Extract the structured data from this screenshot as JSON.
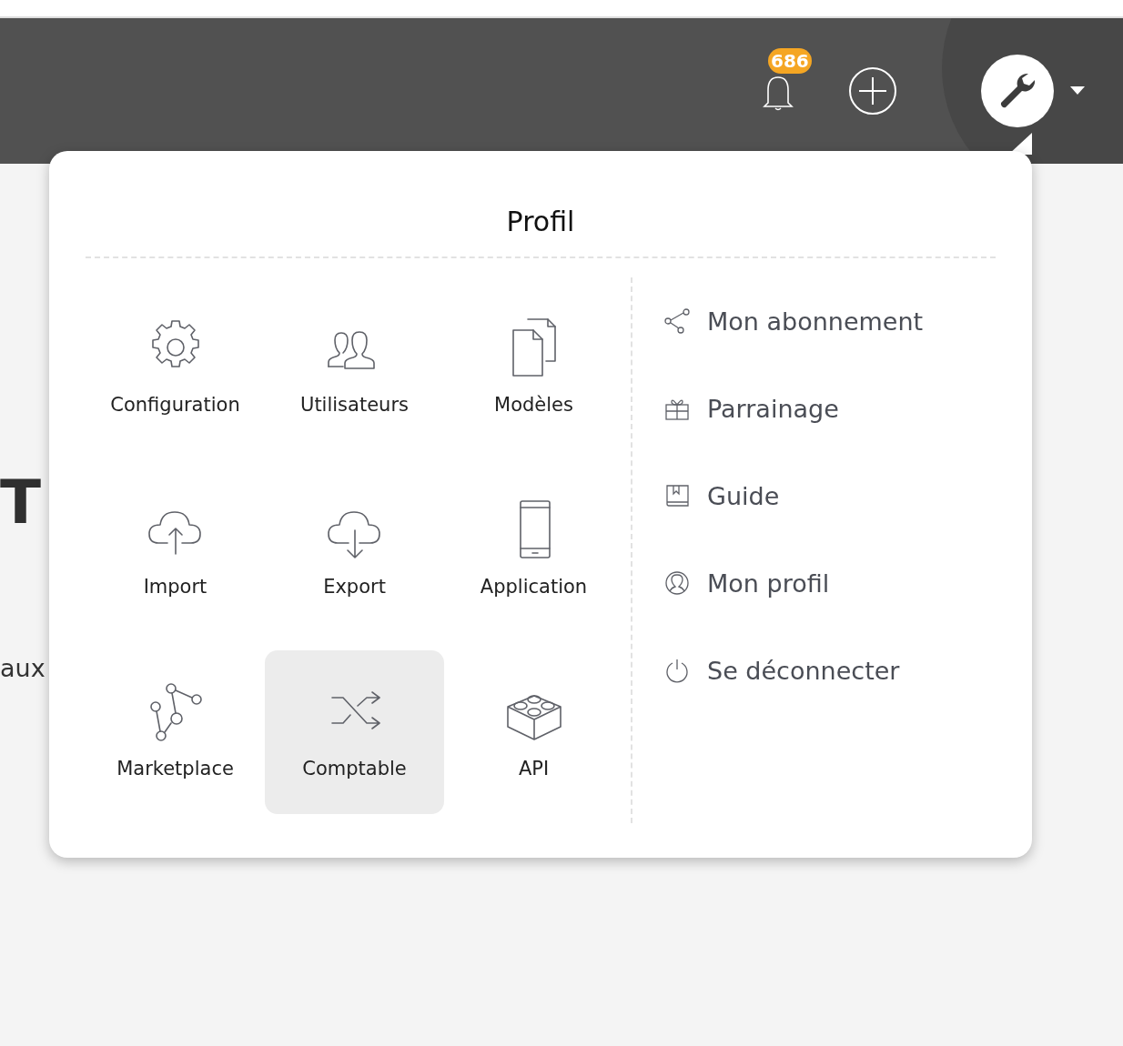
{
  "header": {
    "notification_count": "686"
  },
  "background": {
    "heading": "T",
    "text": "aux"
  },
  "profile_menu": {
    "title": "Profil",
    "tiles": [
      {
        "label": "Configuration",
        "selected": false
      },
      {
        "label": "Utilisateurs",
        "selected": false
      },
      {
        "label": "Modèles",
        "selected": false
      },
      {
        "label": "Import",
        "selected": false
      },
      {
        "label": "Export",
        "selected": false
      },
      {
        "label": "Application",
        "selected": false
      },
      {
        "label": "Marketplace",
        "selected": false
      },
      {
        "label": "Comptable",
        "selected": true
      },
      {
        "label": "API",
        "selected": false
      }
    ],
    "links": [
      {
        "label": "Mon abonnement"
      },
      {
        "label": "Parrainage"
      },
      {
        "label": "Guide"
      },
      {
        "label": "Mon profil"
      },
      {
        "label": "Se déconnecter"
      }
    ]
  }
}
